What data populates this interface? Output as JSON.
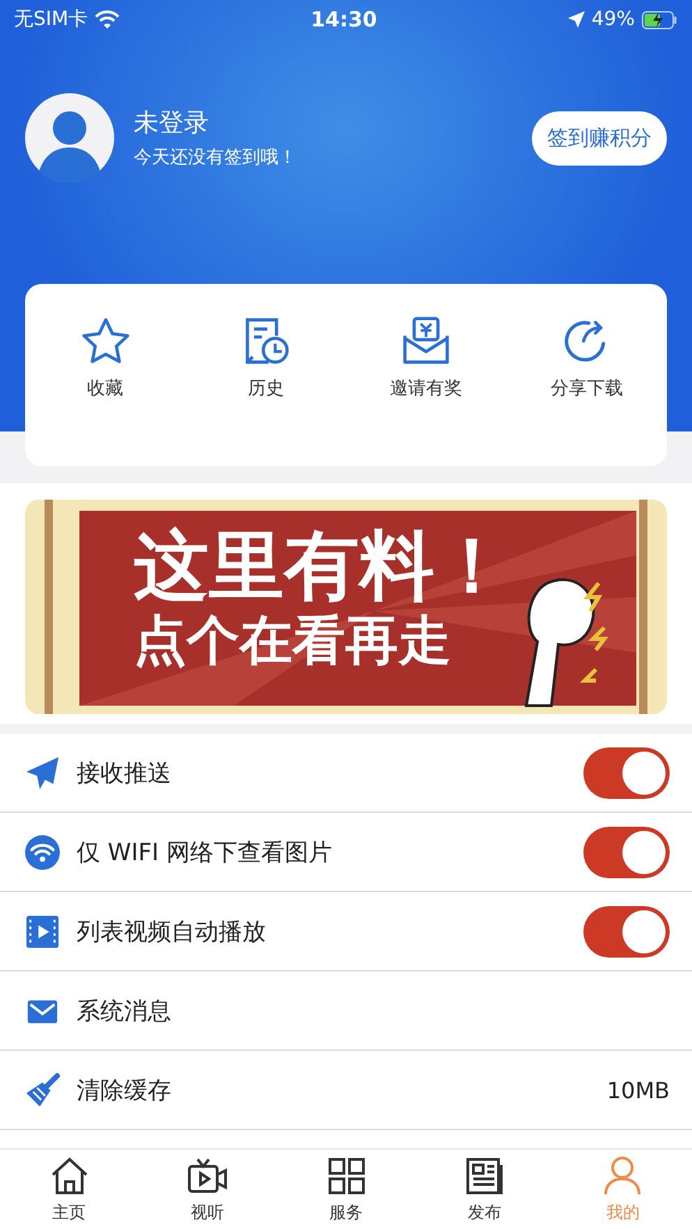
{
  "status_bar": {
    "carrier": "无SIM卡",
    "time": "14:30",
    "battery": "49%"
  },
  "profile": {
    "name": "未登录",
    "subtitle": "今天还没有签到哦！",
    "checkin_button": "签到赚积分"
  },
  "shortcuts": [
    {
      "kind": "star",
      "label": "收藏"
    },
    {
      "kind": "history",
      "label": "历史"
    },
    {
      "kind": "invite",
      "label": "邀请有奖"
    },
    {
      "kind": "share",
      "label": "分享下载"
    }
  ],
  "banner": {
    "title": "这里有料！",
    "subtitle": "点个在看再走"
  },
  "settings": [
    {
      "kind": "toggle",
      "label": "接收推送",
      "on": true
    },
    {
      "kind": "toggle",
      "label": "仅 WIFI 网络下查看图片",
      "on": true
    },
    {
      "kind": "toggle",
      "label": "列表视频自动播放",
      "on": true
    },
    {
      "kind": "link",
      "label": "系统消息"
    },
    {
      "kind": "value",
      "label": "清除缓存",
      "value": "10MB"
    }
  ],
  "tab_bar": [
    {
      "label": "主页",
      "selected": false
    },
    {
      "label": "视听",
      "selected": false
    },
    {
      "label": "服务",
      "selected": false
    },
    {
      "label": "发布",
      "selected": false
    },
    {
      "label": "我的",
      "selected": true
    }
  ]
}
